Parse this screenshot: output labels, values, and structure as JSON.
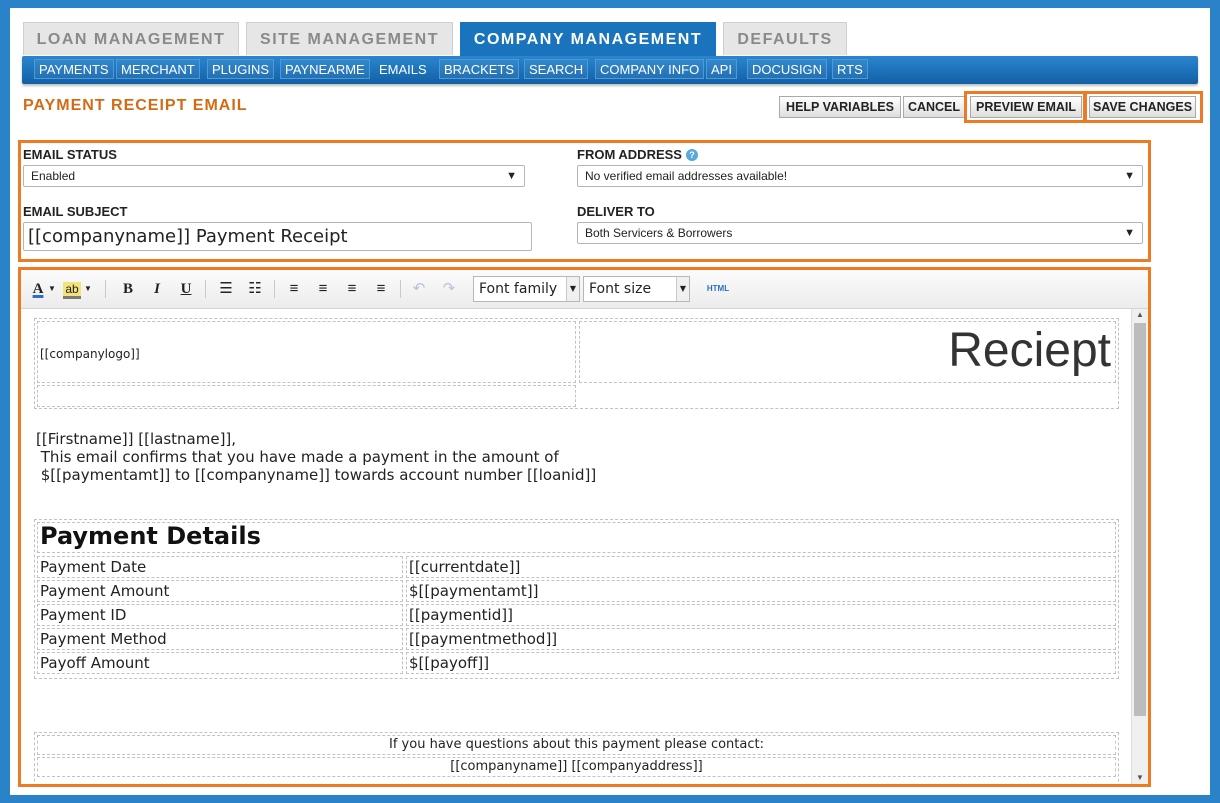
{
  "main_tabs": [
    {
      "label": "LOAN MANAGEMENT",
      "active": false
    },
    {
      "label": "SITE MANAGEMENT",
      "active": false
    },
    {
      "label": "COMPANY MANAGEMENT",
      "active": true
    },
    {
      "label": "DEFAULTS",
      "active": false
    }
  ],
  "sub_nav": [
    {
      "label": "PAYMENTS"
    },
    {
      "label": "MERCHANT"
    },
    {
      "label": "PLUGINS"
    },
    {
      "label": "PAYNEARME"
    },
    {
      "label": "EMAILS",
      "active": true
    },
    {
      "label": "BRACKETS"
    },
    {
      "label": "SEARCH"
    },
    {
      "label": "COMPANY INFO"
    },
    {
      "label": "API"
    },
    {
      "label": "DOCUSIGN"
    },
    {
      "label": "RTS"
    }
  ],
  "page_title": "PAYMENT RECEIPT EMAIL",
  "buttons": {
    "help_variables": "HELP VARIABLES",
    "cancel": "CANCEL",
    "preview_email": "PREVIEW EMAIL",
    "save_changes": "SAVE CHANGES"
  },
  "settings": {
    "email_status_label": "EMAIL STATUS",
    "email_status_value": "Enabled",
    "from_address_label": "FROM ADDRESS",
    "from_address_value": "No verified email addresses available!",
    "email_subject_label": "EMAIL SUBJECT",
    "email_subject_value": "[[companyname]] Payment Receipt",
    "deliver_to_label": "DELIVER TO",
    "deliver_to_value": "Both Servicers & Borrowers"
  },
  "toolbar": {
    "font_family": "Font family",
    "font_size": "Font size",
    "html_label": "HTML",
    "icons": [
      "font-color-icon",
      "highlight-icon",
      "bold-icon",
      "italic-icon",
      "underline-icon",
      "bullet-list-icon",
      "numbered-list-icon",
      "align-left-icon",
      "align-center-icon",
      "align-right-icon",
      "justify-icon",
      "undo-icon",
      "redo-icon"
    ]
  },
  "editor": {
    "logo_tag": "[[companylogo]]",
    "receipt_title": "Reciept",
    "greeting": "[[Firstname]] [[lastname]],",
    "body_line1": " This email confirms that you have made a payment in the amount of",
    "body_line2": " $[[paymentamt]] to [[companyname]] towards account number [[loanid]]",
    "details_title": "Payment Details",
    "details_rows": [
      {
        "label": "Payment Date",
        "value": "[[currentdate]]"
      },
      {
        "label": "Payment Amount",
        "value": "$[[paymentamt]]"
      },
      {
        "label": "Payment ID",
        "value": "[[paymentid]]"
      },
      {
        "label": "Payment Method",
        "value": "[[paymentmethod]]"
      },
      {
        "label": "Payoff Amount",
        "value": "$[[payoff]]"
      }
    ],
    "contact_line": "If you have questions about this payment please contact:",
    "company_line": "[[companyname]] [[companyaddress]]"
  },
  "colors": {
    "accent_orange": "#ee7a23",
    "title_orange": "#d56a14",
    "nav_blue": "#1a74bd",
    "background_blue": "#2a82c8"
  }
}
